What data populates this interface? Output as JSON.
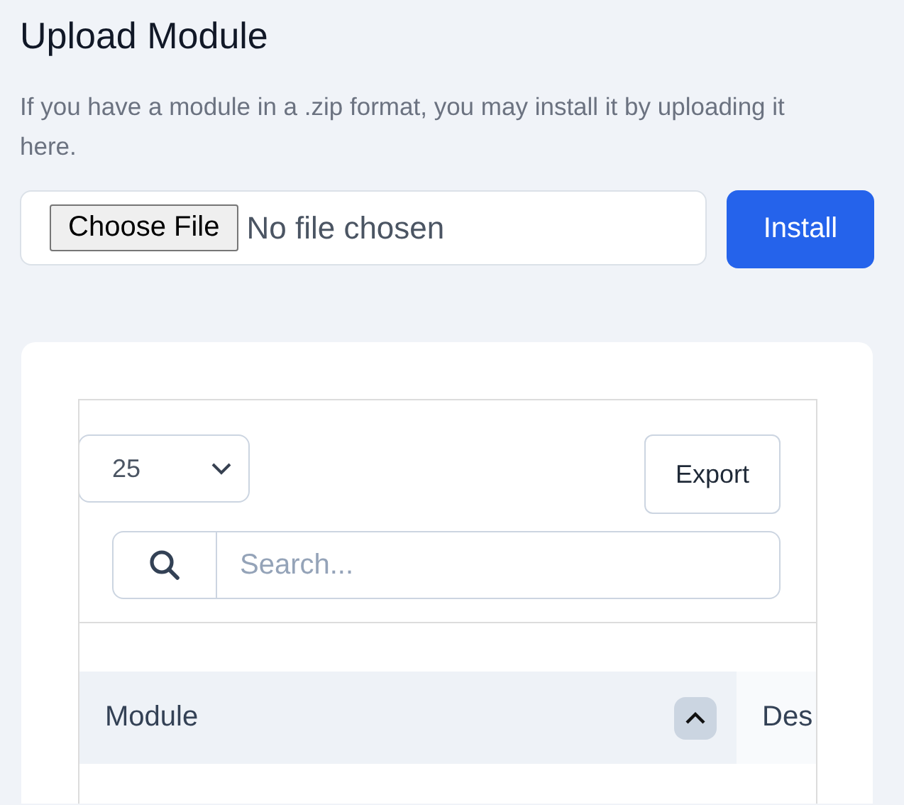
{
  "upload": {
    "title": "Upload Module",
    "description": "If you have a module in a .zip format, you may install it by uploading it here.",
    "file_button": "Choose File",
    "file_status": "No file chosen",
    "install_button": "Install"
  },
  "table": {
    "page_size": "25",
    "export_button": "Export",
    "search": {
      "placeholder": "Search..."
    },
    "columns": [
      {
        "label": "Module"
      },
      {
        "label": "Des"
      }
    ]
  }
}
